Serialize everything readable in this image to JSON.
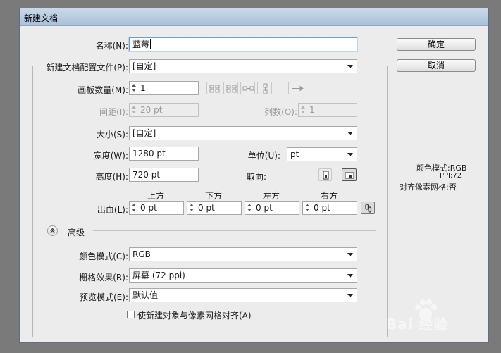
{
  "window": {
    "title": "新建文档"
  },
  "buttons": {
    "ok": "确定",
    "cancel": "取消"
  },
  "form": {
    "name_label": "名称(N):",
    "name_value": "蓝莓",
    "profile_label": "新建文档配置文件(P):",
    "profile_value": "[自定]",
    "artboards_label": "画板数量(M):",
    "artboards_value": "1",
    "spacing_label": "间距(I):",
    "spacing_value": "20 pt",
    "columns_label": "列数(O):",
    "columns_value": "1",
    "size_label": "大小(S):",
    "size_value": "[自定]",
    "width_label": "宽度(W):",
    "width_value": "1280 pt",
    "units_label": "单位(U):",
    "units_value": "pt",
    "height_label": "高度(H):",
    "height_value": "720 pt",
    "orientation_label": "取向:",
    "bleed_label": "出血(L):",
    "bleed_top_label": "上方",
    "bleed_bottom_label": "下方",
    "bleed_left_label": "左方",
    "bleed_right_label": "右方",
    "bleed_top": "0 pt",
    "bleed_bottom": "0 pt",
    "bleed_left": "0 pt",
    "bleed_right": "0 pt"
  },
  "advanced": {
    "label": "高级",
    "color_mode_label": "颜色模式(C):",
    "color_mode_value": "RGB",
    "raster_label": "栅格效果(R):",
    "raster_value": "屏幕 (72 ppi)",
    "preview_label": "预览模式(E):",
    "preview_value": "默认值",
    "align_pixel_grid_label": "使新建对象与像素网格对齐(A)"
  },
  "info": {
    "color_mode": "颜色模式:RGB",
    "ppi": "PPI:72",
    "align_grid": "对齐像素网格:否"
  },
  "watermark": {
    "text": "Bai 经验"
  },
  "icons": {
    "arrangement_icons": [
      "grid-by-row-icon",
      "grid-by-column-icon",
      "arrange-by-row-icon",
      "arrange-by-column-icon",
      "change-to-rtl-icon"
    ],
    "orientation_icons": [
      "portrait-icon",
      "landscape-icon"
    ],
    "link_icon": "link-bleed-icon",
    "collapse_icon": "collapse-advanced-icon"
  }
}
